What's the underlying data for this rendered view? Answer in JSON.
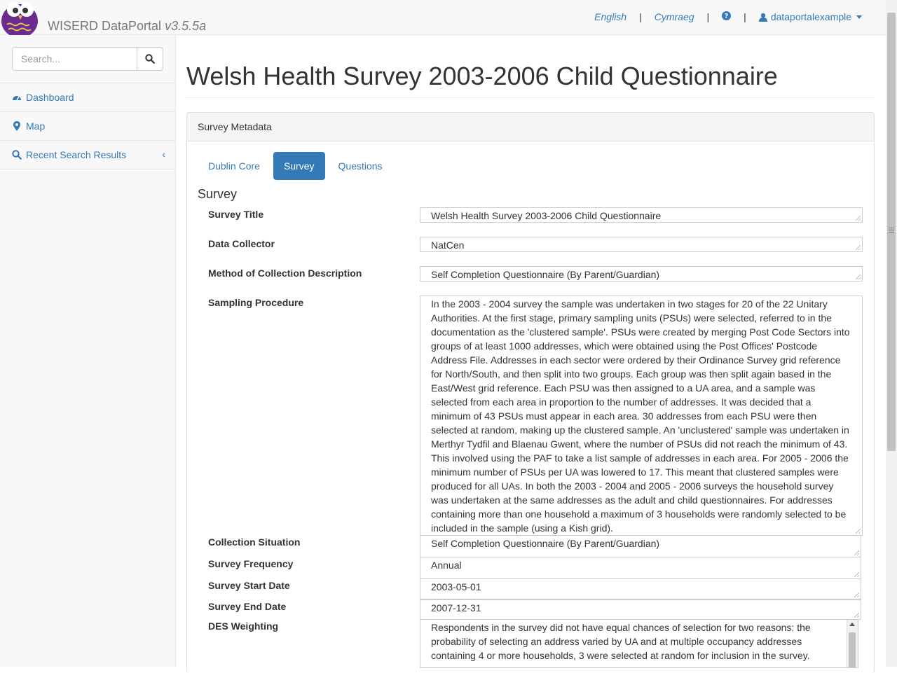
{
  "header": {
    "brand": "WISERD DataPortal",
    "version": "v3.5.5a",
    "lang_english": "English",
    "lang_welsh": "Cymraeg",
    "separator": "|",
    "username": "dataportalexample"
  },
  "sidebar": {
    "search_placeholder": "Search...",
    "items": [
      {
        "label": "Dashboard",
        "icon": "dashboard-icon"
      },
      {
        "label": "Map",
        "icon": "map-marker-icon"
      },
      {
        "label": "Recent Search Results",
        "icon": "search-icon"
      }
    ],
    "collapse_glyph": "‹"
  },
  "page": {
    "title": "Welsh Health Survey 2003-2006 Child Questionnaire",
    "panel_heading": "Survey Metadata",
    "tabs": [
      "Dublin Core",
      "Survey",
      "Questions"
    ],
    "active_tab": "Survey",
    "section_title": "Survey"
  },
  "fields": {
    "survey_title": {
      "label": "Survey Title",
      "value": "Welsh Health Survey 2003-2006 Child Questionnaire"
    },
    "data_collector": {
      "label": "Data Collector",
      "value": "NatCen"
    },
    "method": {
      "label": "Method of Collection Description",
      "value": "Self Completion Questionnaire (By Parent/Guardian)"
    },
    "sampling": {
      "label": "Sampling Procedure",
      "value": "In the 2003 - 2004 survey the sample was undertaken in two stages for 20 of the 22 Unitary Authorities. At the first stage, primary sampling units (PSUs) were selected, referred to in the documentation as the 'clustered sample'. PSUs were created by merging Post Code Sectors into groups of at least 1000 addresses, which were obtained using the Post Offices' Postcode Address File. Addresses in each sector were ordered by their Ordinance Survey grid reference for North/South, and then split into two groups. Each group was then split again based in the East/West grid reference. Each PSU was then assigned to a UA area, and a sample was selected from each area in proportion to the number of addresses. It was decided that a minimum of 43 PSUs must appear in each area. 30 addresses from each PSU were then selected at random, making up the clustered sample. An 'unclustered' sample was undertaken in  Merthyr Tydfil and Blaenau Gwent, where the number of PSUs did not reach the minimum of 43. This involved using the PAF to take a list sample of addresses in each area. For 2005 - 2006 the minimum number of PSUs per UA was lowered to 17. This meant that clustered samples were produced for all UAs. In both the 2003 - 2004 and 2005 - 2006 surveys the household survey was undertaken at the same addresses as the adult and child questionnaires. For addresses containing more than one household a maximum of 3 households were randomly selected to be included in the sample (using a Kish grid)."
    },
    "collection_situation": {
      "label": "Collection Situation",
      "value": "Self Completion Questionnaire (By Parent/Guardian)"
    },
    "frequency": {
      "label": "Survey Frequency",
      "value": "Annual"
    },
    "start_date": {
      "label": "Survey Start Date",
      "value": "2003-05-01"
    },
    "end_date": {
      "label": "Survey End Date",
      "value": "2007-12-31"
    },
    "des_weighting": {
      "label": "DES Weighting",
      "value": "Respondents in the survey did not have equal chances of selection for two reasons: the probability of selecting an address varied by UA and at multiple occupancy addresses containing 4 or more households, 3 were selected at random for inclusion in the survey."
    }
  },
  "colors": {
    "accent": "#337ab7",
    "owl": "#6b2c91"
  }
}
